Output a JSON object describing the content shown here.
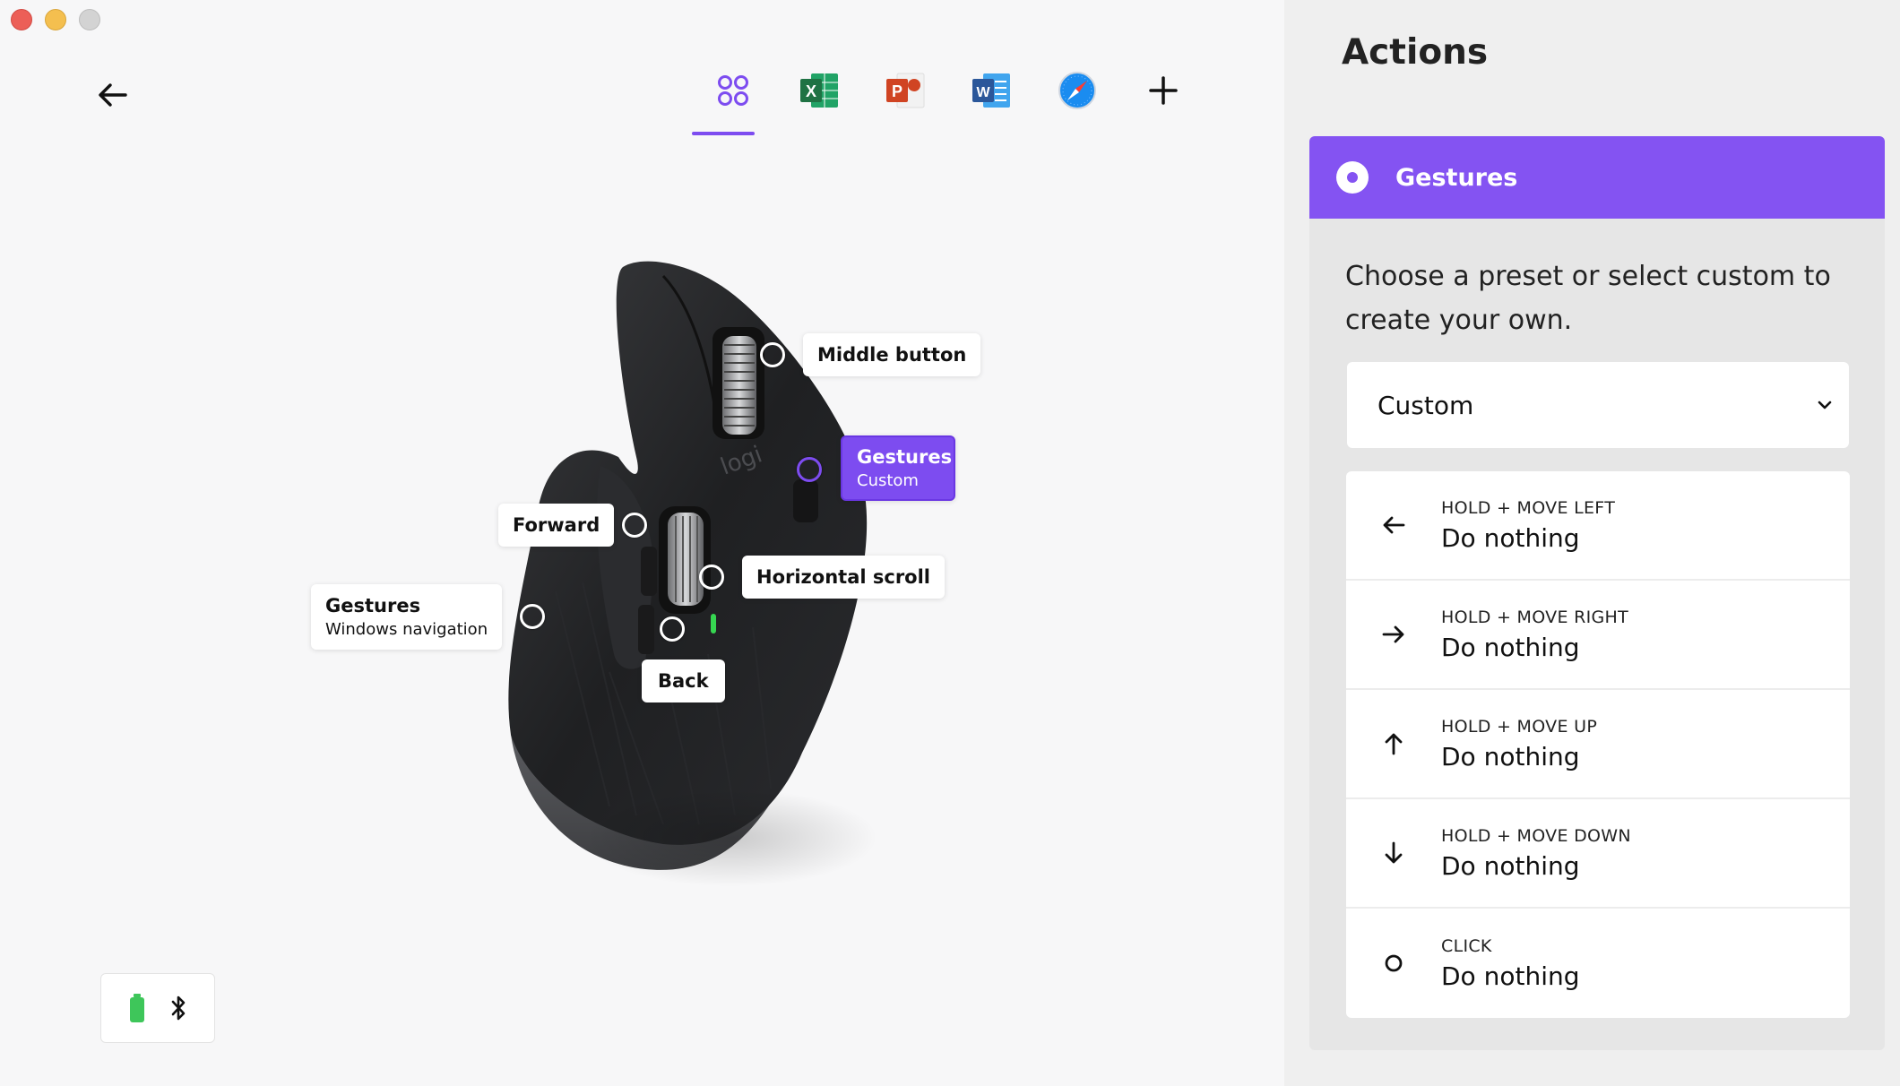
{
  "window": {
    "controls": [
      "close",
      "minimize",
      "maximize"
    ]
  },
  "nav": {
    "back_icon": "arrow-left-icon"
  },
  "app_tabs": [
    {
      "name": "all-apps",
      "icon": "grid-apps-icon",
      "active": true
    },
    {
      "name": "excel",
      "icon": "excel-icon",
      "letter": "X",
      "color": "#1f7244"
    },
    {
      "name": "powerpoint",
      "icon": "powerpoint-icon",
      "letter": "P",
      "color": "#d04423"
    },
    {
      "name": "word",
      "icon": "word-icon",
      "letter": "W",
      "color": "#2b579a"
    },
    {
      "name": "safari",
      "icon": "safari-icon",
      "color": "#1a8cf0"
    },
    {
      "name": "add-app",
      "icon": "plus-icon"
    }
  ],
  "callouts": {
    "middle_button": {
      "title": "Middle button"
    },
    "gestures_top": {
      "title": "Gestures",
      "sub": "Custom",
      "active": true
    },
    "forward": {
      "title": "Forward"
    },
    "horizontal_scroll": {
      "title": "Horizontal scroll"
    },
    "gestures_thumb": {
      "title": "Gestures",
      "sub": "Windows navigation"
    },
    "back": {
      "title": "Back"
    }
  },
  "device_status": {
    "battery_icon": "battery-icon",
    "battery_color": "#3ec65a",
    "connection_icon": "bluetooth-icon"
  },
  "panel": {
    "title": "Actions",
    "selected_action": "Gestures",
    "description": "Choose a preset or select custom to create your own.",
    "preset": {
      "value": "Custom",
      "icon": "chevron-down-icon"
    },
    "gestures": [
      {
        "key": "HOLD + MOVE LEFT",
        "value": "Do nothing",
        "icon": "arrow-left-icon"
      },
      {
        "key": "HOLD + MOVE RIGHT",
        "value": "Do nothing",
        "icon": "arrow-right-icon"
      },
      {
        "key": "HOLD + MOVE UP",
        "value": "Do nothing",
        "icon": "arrow-up-icon"
      },
      {
        "key": "HOLD + MOVE DOWN",
        "value": "Do nothing",
        "icon": "arrow-down-icon"
      },
      {
        "key": "CLICK",
        "value": "Do nothing",
        "icon": "circle-icon"
      }
    ]
  },
  "colors": {
    "accent": "#8453f2",
    "panel_bg": "#efefef"
  }
}
